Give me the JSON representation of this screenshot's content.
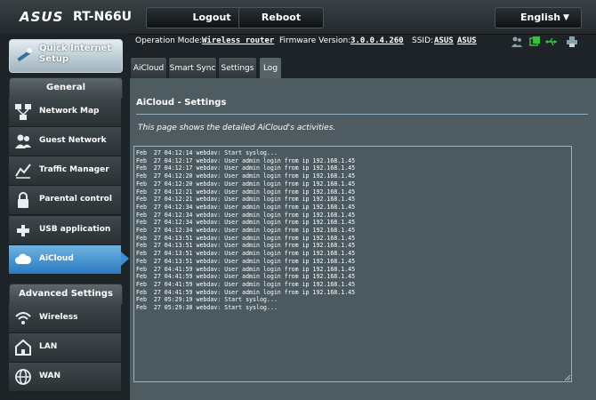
{
  "header": {
    "brand": "ASUS",
    "model": "RT-N66U",
    "logout_label": "Logout",
    "reboot_label": "Reboot",
    "language": "English"
  },
  "status": {
    "op_mode_label": "Operation Mode:",
    "op_mode_value": "Wireless router",
    "firmware_label": "Firmware Version:",
    "firmware_value": "3.0.0.4.260",
    "ssid_label": "SSID:",
    "ssid_1": "ASUS",
    "ssid_2": "ASUS"
  },
  "sidebar": {
    "quick_setup_label": "Quick Internet Setup",
    "general_title": "General",
    "general_items": [
      {
        "label": "Network Map",
        "icon": "network-map-icon"
      },
      {
        "label": "Guest Network",
        "icon": "guest-network-icon"
      },
      {
        "label": "Traffic Manager",
        "icon": "traffic-manager-icon"
      },
      {
        "label": "Parental control",
        "icon": "parental-control-icon"
      },
      {
        "label": "USB application",
        "icon": "usb-icon"
      },
      {
        "label": "AiCloud",
        "icon": "cloud-icon"
      }
    ],
    "advanced_title": "Advanced Settings",
    "advanced_items": [
      {
        "label": "Wireless",
        "icon": "wireless-icon"
      },
      {
        "label": "LAN",
        "icon": "lan-icon"
      },
      {
        "label": "WAN",
        "icon": "wan-icon"
      }
    ]
  },
  "tabs": [
    "AiCloud",
    "Smart Sync",
    "Settings",
    "Log"
  ],
  "active_tab": "Log",
  "active_nav": "AiCloud",
  "main": {
    "title": "AiCloud - Settings",
    "description": "This page shows the detailed AiCloud's activities.",
    "log_lines": [
      "Feb  27 04:12:14 webdav: Start syslog...",
      "Feb  27 04:12:17 webdav: User admin login from ip 192.168.1.45",
      "Feb  27 04:12:17 webdav: User admin login from ip 192.168.1.45",
      "Feb  27 04:12:20 webdav: User admin login from ip 192.168.1.45",
      "Feb  27 04:12:20 webdav: User admin login from ip 192.168.1.45",
      "Feb  27 04:12:21 webdav: User admin login from ip 192.168.1.45",
      "Feb  27 04:12:21 webdav: User admin login from ip 192.168.1.45",
      "Feb  27 04:12:34 webdav: User admin login from ip 192.168.1.45",
      "Feb  27 04:12:34 webdav: User admin login from ip 192.168.1.45",
      "Feb  27 04:12:34 webdav: User admin login from ip 192.168.1.45",
      "Feb  27 04:12:34 webdav: User admin login from ip 192.168.1.45",
      "Feb  27 04:13:51 webdav: User admin login from ip 192.168.1.45",
      "Feb  27 04:13:51 webdav: User admin login from ip 192.168.1.45",
      "Feb  27 04:13:51 webdav: User admin login from ip 192.168.1.45",
      "Feb  27 04:13:51 webdav: User admin login from ip 192.168.1.45",
      "Feb  27 04:41:59 webdav: User admin login from ip 192.168.1.45",
      "Feb  27 04:41:59 webdav: User admin login from ip 192.168.1.45",
      "Feb  27 04:41:59 webdav: User admin login from ip 192.168.1.45",
      "Feb  27 04:41:59 webdav: User admin login from ip 192.168.1.45",
      "Feb  27 05:29:19 webdav: Start syslog...",
      "Feb  27 05:29:38 webdav: Start syslog..."
    ]
  },
  "colors": {
    "accent_blue": "#2a7bbf",
    "panel": "#4e5b61",
    "status_icon_green": "#35c23a"
  }
}
